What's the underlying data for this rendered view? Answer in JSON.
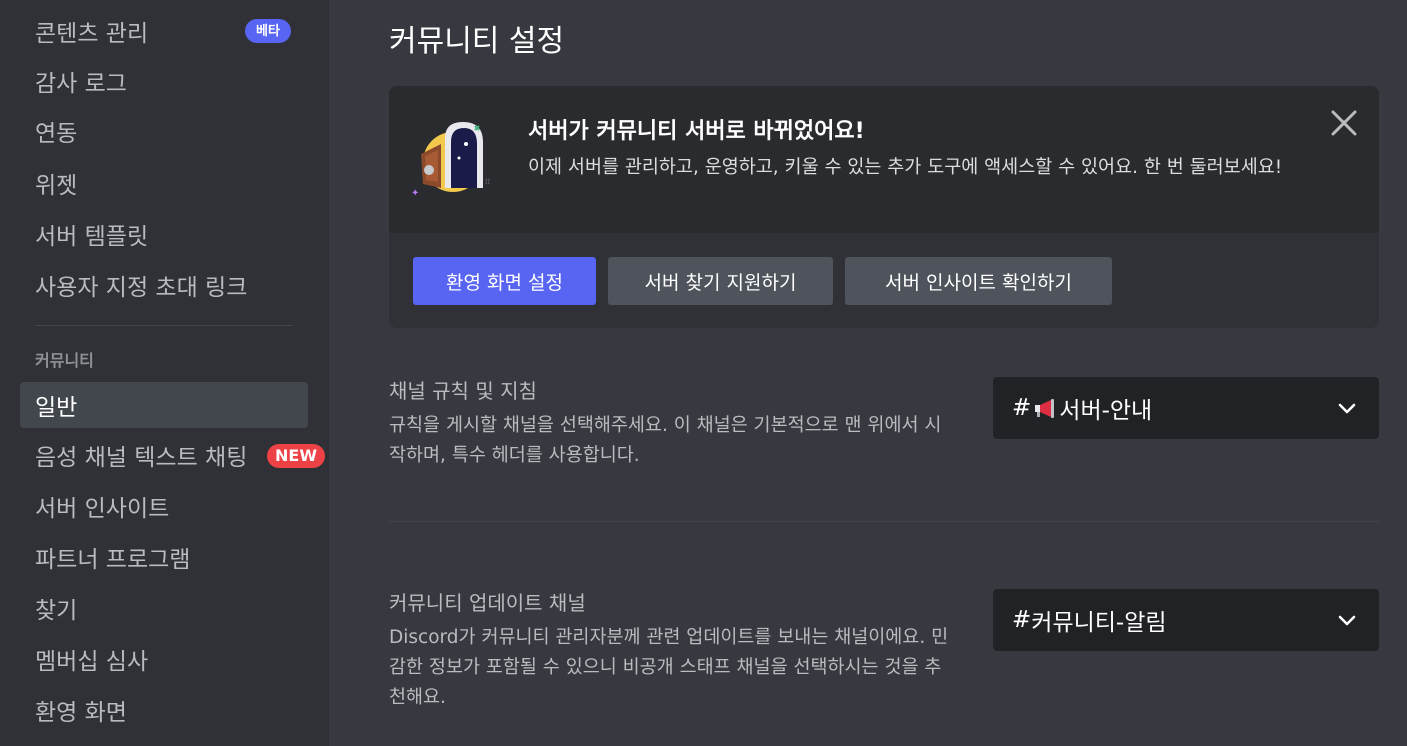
{
  "sidebar": {
    "items": [
      {
        "label": "콘텐츠 관리",
        "badge": "베타"
      },
      {
        "label": "감사 로그"
      },
      {
        "label": "연동"
      },
      {
        "label": "위젯"
      },
      {
        "label": "서버 템플릿"
      },
      {
        "label": "사용자 지정 초대 링크"
      }
    ],
    "section_header": "커뮤니티",
    "community_items": [
      {
        "label": "일반",
        "selected": true
      },
      {
        "label": "음성 채널 텍스트 채팅",
        "badge": "NEW"
      },
      {
        "label": "서버 인사이트"
      },
      {
        "label": "파트너 프로그램"
      },
      {
        "label": "찾기"
      },
      {
        "label": "멤버십 심사"
      },
      {
        "label": "환영 화면"
      }
    ]
  },
  "main": {
    "title": "커뮤니티 설정",
    "banner": {
      "title": "서버가 커뮤니티 서버로 바뀌었어요!",
      "description": "이제 서버를 관리하고, 운영하고, 키울 수 있는 추가 도구에 액세스할 수 있어요. 한 번 둘러보세요!",
      "buttons": [
        "환영 화면 설정",
        "서버 찾기 지원하기",
        "서버 인사이트 확인하기"
      ]
    },
    "settings": [
      {
        "label": "채널 규칙 및 지침",
        "description": "규칙을 게시할 채널을 선택해주세요. 이 채널은 기본적으로 맨 위에서 시작하며, 특수 헤더를 사용합니다.",
        "selected_prefix": "#",
        "selected_value": "서버-안내",
        "selected_icon": "megaphone-icon"
      },
      {
        "label": "커뮤니티 업데이트 채널",
        "description": "Discord가 커뮤니티 관리자분께 관련 업데이트를 보내는 채널이에요. 민감한 정보가 포함될 수 있으니 비공개 스태프 채널을 선택하시는 것을 추천해요.",
        "selected_prefix": "#",
        "selected_value": "커뮤니티-알림"
      }
    ]
  },
  "colors": {
    "background": "#36393f",
    "sidebar": "#2f3136",
    "accent": "#5865f2",
    "new_badge": "#ed4245"
  }
}
